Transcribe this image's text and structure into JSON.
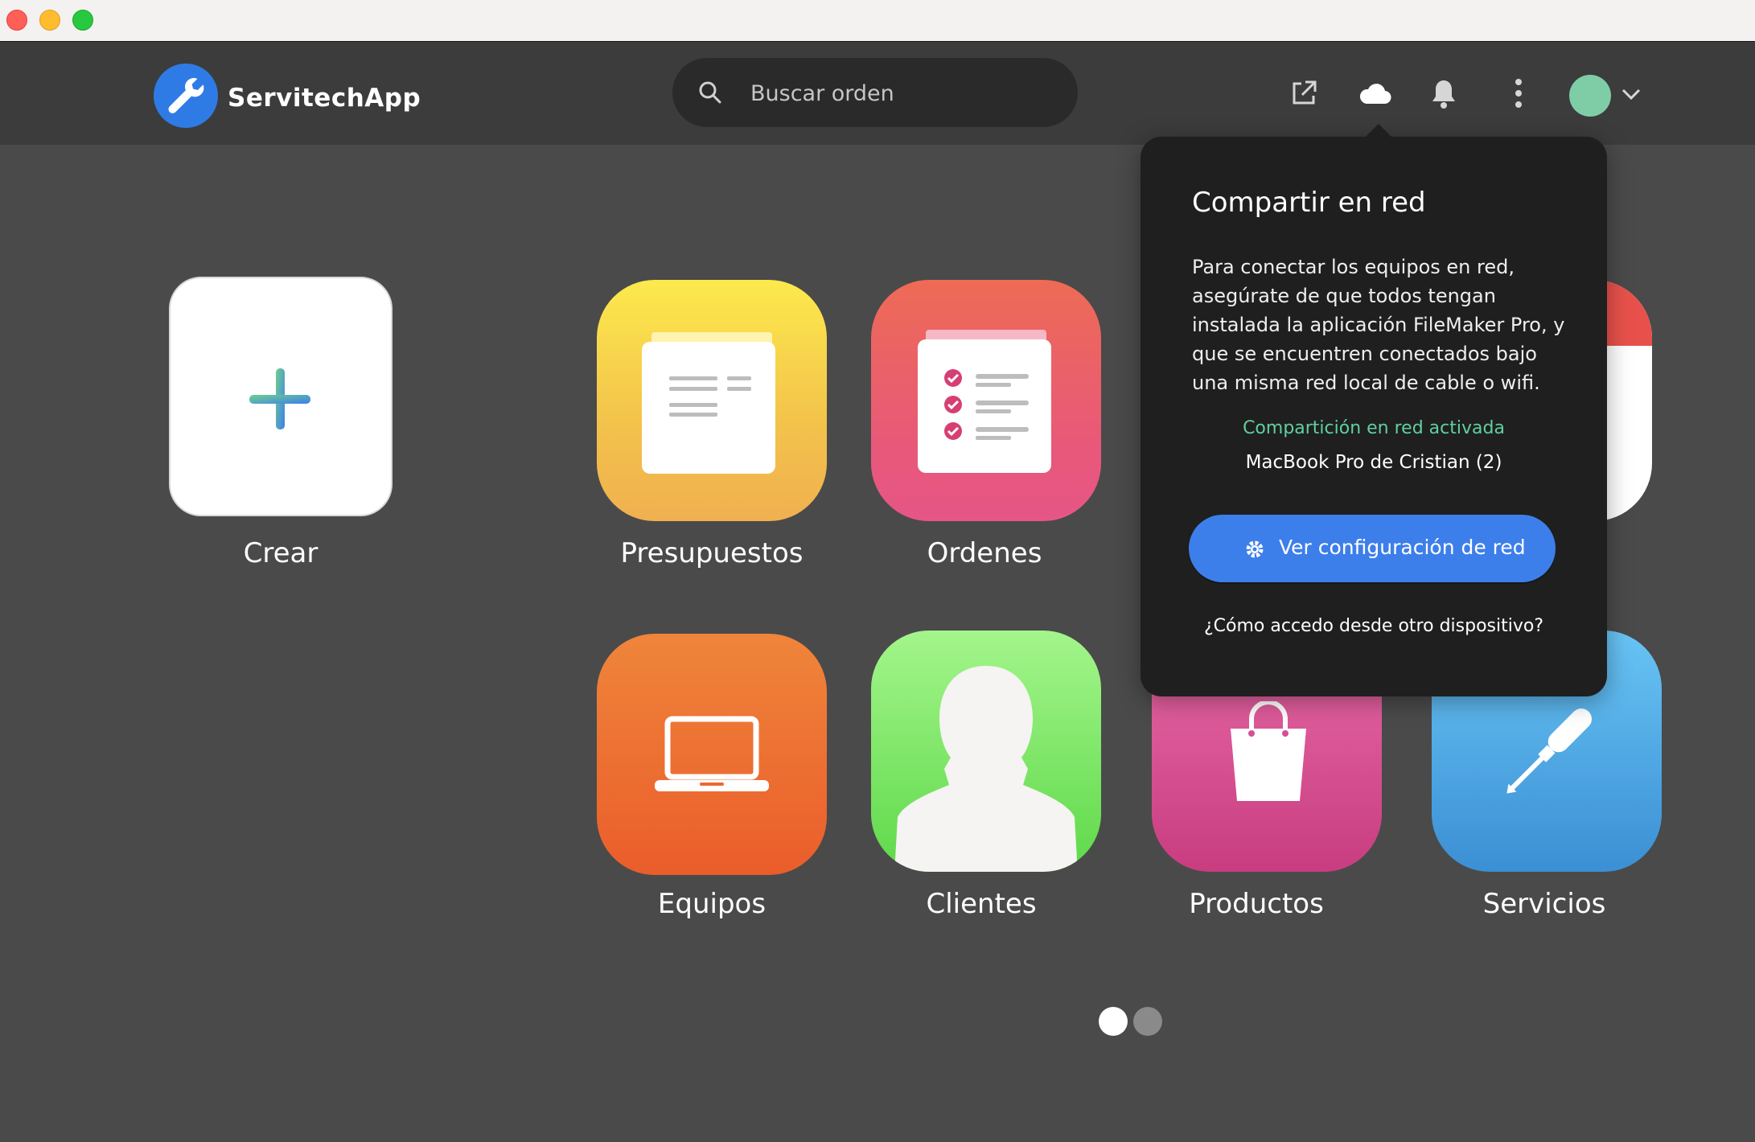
{
  "window": {
    "traffic_lights": [
      "close",
      "minimize",
      "zoom"
    ]
  },
  "header": {
    "brand": "ServitechApp",
    "search_placeholder": "Buscar orden",
    "icons": [
      "external-link-icon",
      "cloud-icon",
      "bell-icon",
      "more-vertical-icon"
    ],
    "avatar_color": "#7fcda7"
  },
  "tiles": {
    "crear": "Crear",
    "presupuestos": "Presupuestos",
    "ordenes": "Ordenes",
    "equipos": "Equipos",
    "clientes": "Clientes",
    "productos": "Productos",
    "servicios": "Servicios"
  },
  "popover": {
    "title": "Compartir en red",
    "body": "Para conectar los equipos en red, asegúrate de que todos tengan instalada la aplicación FileMaker Pro, y que se encuentren conectados bajo una misma red local de cable o wifi.",
    "status": "Compartición en red activada",
    "device": "MacBook Pro de Cristian (2)",
    "button": "Ver configuración de red",
    "help": "¿Cómo accedo desde otro dispositivo?"
  },
  "pager": {
    "pages": 2,
    "current": 1
  },
  "colors": {
    "background": "#4a4a4a",
    "header": "#3c3c3c",
    "accent_blue": "#3d7fea",
    "status_green": "#5fd0a0"
  }
}
